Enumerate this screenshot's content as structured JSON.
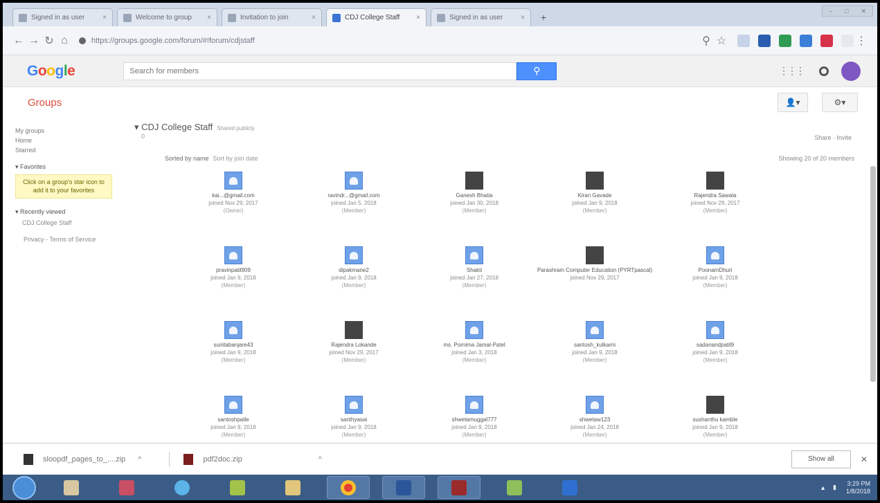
{
  "browser": {
    "tabs": [
      {
        "label": "Signed in as user",
        "active": false
      },
      {
        "label": "Welcome to group",
        "active": false
      },
      {
        "label": "Invitation to join",
        "active": false
      },
      {
        "label": "CDJ College Staff",
        "active": true
      },
      {
        "label": "Signed in as user",
        "active": false
      }
    ],
    "url": "https://groups.google.com/forum/#!forum/cdjstaff",
    "new_tab": "+"
  },
  "google": {
    "logo": "Google",
    "search_placeholder": "Search for members"
  },
  "groups": {
    "title": "Groups"
  },
  "sidebar": {
    "links": [
      "My groups",
      "Home",
      "Starred"
    ],
    "favorites_heading": "Favorites",
    "favorites_note": "Click on a group's star icon to add it to your favorites",
    "recent_heading": "Recently viewed",
    "recent_items": [
      "CDJ College Staff"
    ],
    "footer": "Privacy - Terms of Service"
  },
  "main": {
    "group_title": "CDJ College Staff",
    "group_subtitle": "Shared publicly",
    "group_desc": "0",
    "sort_label": "Sorted by name",
    "sort_alt": "Sort by join date",
    "top_links": "Share · Invite",
    "showing": "Showing 20 of 20 members"
  },
  "members": [
    {
      "name": "kai...@gmail.com",
      "joined": "joined Nov 29, 2017",
      "role": "(Owner)",
      "pic": "default"
    },
    {
      "name": "ravindr...@gmail.com",
      "joined": "joined Jan 5, 2018",
      "role": "(Member)",
      "pic": "default"
    },
    {
      "name": "Ganesh Bhatia",
      "joined": "joined Jan 30, 2018",
      "role": "(Member)",
      "pic": "photo"
    },
    {
      "name": "Kiran Gavade",
      "joined": "joined Jan 9, 2018",
      "role": "(Member)",
      "pic": "photo"
    },
    {
      "name": "Rajendra Sawala",
      "joined": "joined Nov 29, 2017",
      "role": "(Member)",
      "pic": "photo"
    },
    {
      "name": "pravinpatil909",
      "joined": "joined Jan 9, 2018",
      "role": "(Member)",
      "pic": "default"
    },
    {
      "name": "dipakmane2",
      "joined": "joined Jan 9, 2018",
      "role": "(Member)",
      "pic": "default"
    },
    {
      "name": "Shakti",
      "joined": "joined Jan 27, 2018",
      "role": "(Member)",
      "pic": "default"
    },
    {
      "name": "Parashram Computer Education (PYRTpascal)",
      "joined": "joined Nov 29, 2017",
      "role": "",
      "pic": "photo"
    },
    {
      "name": "PoonamDhuri",
      "joined": "joined Jan 9, 2018",
      "role": "(Member)",
      "pic": "default"
    },
    {
      "name": "sunitabanjare43",
      "joined": "joined Jan 9, 2018",
      "role": "(Member)",
      "pic": "default"
    },
    {
      "name": "Rajendra Lokande",
      "joined": "joined Nov 29, 2017",
      "role": "(Member)",
      "pic": "photo"
    },
    {
      "name": "ms. Pornima Jamal-Patel",
      "joined": "joined Jan 3, 2018",
      "role": "(Member)",
      "pic": "default"
    },
    {
      "name": "santosh_kulkarni",
      "joined": "joined Jan 9, 2018",
      "role": "(Member)",
      "pic": "default"
    },
    {
      "name": "sadanandpatil9",
      "joined": "joined Jan 9, 2018",
      "role": "(Member)",
      "pic": "default"
    },
    {
      "name": "santoshpatle",
      "joined": "joined Jan 9, 2018",
      "role": "(Member)",
      "pic": "default"
    },
    {
      "name": "santhyasai",
      "joined": "joined Jan 9, 2018",
      "role": "(Member)",
      "pic": "default"
    },
    {
      "name": "shwetamuggal777",
      "joined": "joined Jan 9, 2018",
      "role": "(Member)",
      "pic": "default"
    },
    {
      "name": "shwetaw123",
      "joined": "joined Jan 24, 2018",
      "role": "(Member)",
      "pic": "default"
    },
    {
      "name": "sushanthu kamble",
      "joined": "joined Jan 9, 2018",
      "role": "(Member)",
      "pic": "photo"
    }
  ],
  "downloads": {
    "items": [
      {
        "name": "sloopdf_pages_to_....zip"
      },
      {
        "name": "pdf2doc.zip"
      }
    ],
    "show_all": "Show all"
  },
  "taskbar": {
    "clock_time": "3:29 PM",
    "clock_date": "1/8/2018"
  }
}
